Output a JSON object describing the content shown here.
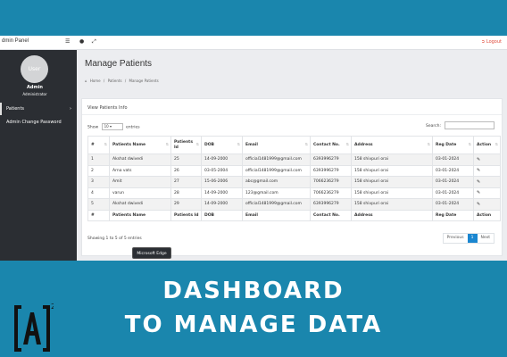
{
  "topbar": {
    "brand": "dmin Panel",
    "icons": [
      "list-icon",
      "user-icon",
      "expand-icon"
    ],
    "logout_label": "Logout"
  },
  "sidebar": {
    "avatar_text": "User",
    "admin_name": "Admin",
    "admin_role": "Administrator",
    "items": [
      {
        "label": "Patients"
      },
      {
        "label": "Admin Change Password"
      }
    ]
  },
  "main": {
    "title": "Manage Patients",
    "breadcrumb": [
      "Home",
      "/",
      "Patients",
      "/",
      "Manage Patients"
    ],
    "card_title": "View Patients Info",
    "show_label": "Show",
    "entries_value": "10",
    "entries_label": "entries",
    "search_label": "Search:",
    "search_value": "",
    "table": {
      "headers": [
        "#",
        "Patients Name",
        "Patients Id",
        "DOB",
        "Email",
        "Contact No.",
        "Address",
        "Reg Date",
        "Action"
      ],
      "rows": [
        [
          "1",
          "Akshat dwivedi",
          "25",
          "14-09-2000",
          "official1481999@gmail.com",
          "6393996279",
          "158 shivpuri orai",
          "03-01-2024"
        ],
        [
          "2",
          "Arna vats",
          "26",
          "03-05-2004",
          "official1481999@gmail.com",
          "6393996279",
          "158 shivpuri orai",
          "03-01-2024"
        ],
        [
          "3",
          "Amit",
          "27",
          "15-06-2006",
          "abc@gmail.com",
          "7066236279",
          "158 shivpuri orai",
          "03-01-2024"
        ],
        [
          "4",
          "varun",
          "28",
          "14-09-2000",
          "123@gmail.com",
          "7066236279",
          "158 shivpuri orai",
          "03-01-2024"
        ],
        [
          "5",
          "Akshat dwivedi",
          "29",
          "14-09-2000",
          "official1481999@gmail.com",
          "6393996279",
          "158 shivpuri orai",
          "03-01-2024"
        ]
      ],
      "footer": [
        "#",
        "Patients Name",
        "Patients Id",
        "DOB",
        "Email",
        "Contact No.",
        "Address",
        "Reg Date",
        "Action"
      ]
    },
    "info": "Showing 1 to 5 of 5 entries",
    "pager": {
      "previous": "Previous",
      "current": "1",
      "next": "Next"
    }
  },
  "tooltip": "Microsoft Edge",
  "banner": {
    "line1": "DASHBOARD",
    "line2": "TO MANAGE DATA"
  },
  "logo": {
    "text": "[A]",
    "superscript": "2"
  },
  "colors": {
    "background": "#1a86ad",
    "sidebar": "#2b2e33",
    "accent": "#1a86d0",
    "logout": "#e04a3b"
  }
}
